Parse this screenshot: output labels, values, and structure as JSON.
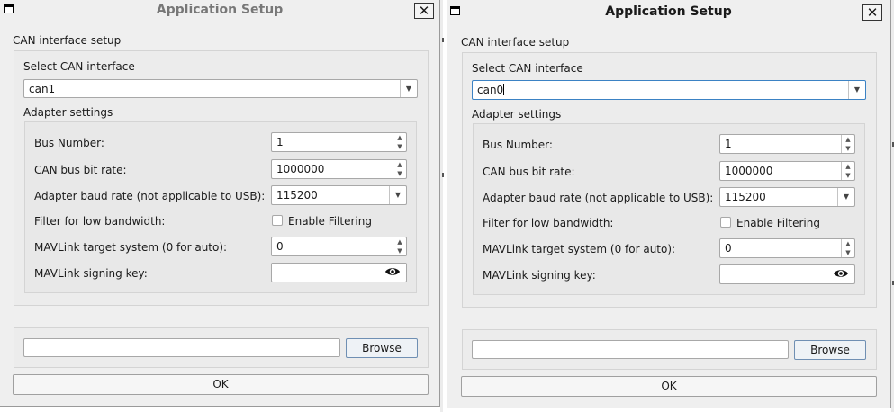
{
  "windows": [
    {
      "title": "Application Setup",
      "close_glyph": "✕",
      "group_title": "CAN interface setup",
      "select_label": "Select CAN interface",
      "interface_value": "can1",
      "adapter_title": "Adapter settings",
      "bus_number_label": "Bus Number:",
      "bus_number_value": "1",
      "bitrate_label": "CAN bus bit rate:",
      "bitrate_value": "1000000",
      "baud_label": "Adapter baud rate (not applicable to USB):",
      "baud_value": "115200",
      "filter_label": "Filter for low bandwidth:",
      "filter_checkbox_label": "Enable Filtering",
      "filter_checked": false,
      "mav_target_label": "MAVLink target system (0 for auto):",
      "mav_target_value": "0",
      "signing_key_label": "MAVLink signing key:",
      "signing_key_value": "",
      "file_path_value": "",
      "browse_label": "Browse",
      "ok_label": "OK"
    },
    {
      "title": "Application Setup",
      "close_glyph": "✕",
      "group_title": "CAN interface setup",
      "select_label": "Select CAN interface",
      "interface_value": "can0",
      "adapter_title": "Adapter settings",
      "bus_number_label": "Bus Number:",
      "bus_number_value": "1",
      "bitrate_label": "CAN bus bit rate:",
      "bitrate_value": "1000000",
      "baud_label": "Adapter baud rate (not applicable to USB):",
      "baud_value": "115200",
      "filter_label": "Filter for low bandwidth:",
      "filter_checkbox_label": "Enable Filtering",
      "filter_checked": false,
      "mav_target_label": "MAVLink target system (0 for auto):",
      "mav_target_value": "0",
      "signing_key_label": "MAVLink signing key:",
      "signing_key_value": "",
      "file_path_value": "",
      "browse_label": "Browse",
      "ok_label": "OK"
    }
  ],
  "icons": {
    "window_menu": "window-menu-icon",
    "close": "close-icon",
    "combo_arrow": "chevron-down-icon",
    "spin_up": "spin-up-icon",
    "spin_down": "spin-down-icon",
    "show_password": "eye-icon"
  },
  "colors": {
    "window_bg": "#efefef",
    "focus_border": "#3b82c4",
    "default_button_border": "#6f8fb3"
  }
}
